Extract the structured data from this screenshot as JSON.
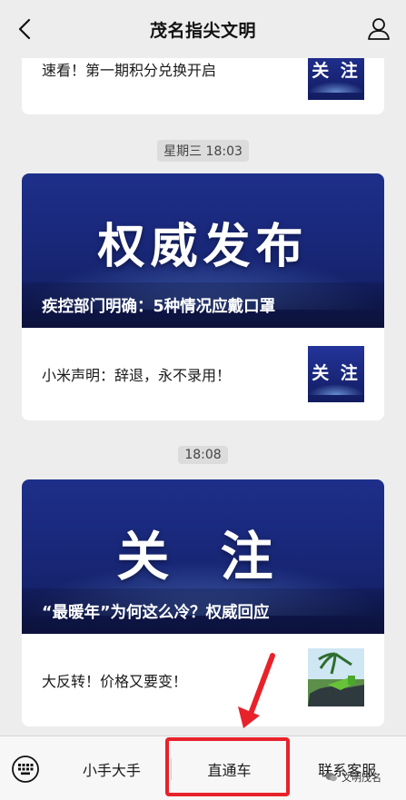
{
  "header": {
    "title": "茂名指尖文明"
  },
  "feed": {
    "card1": {
      "text": "速看！第一期积分兑换开启",
      "thumb_text": "关 注"
    },
    "timestamp1": "星期三 18:03",
    "card2": {
      "hero_text": "权威发布",
      "hero_caption": "疾控部门明确：5种情况应戴口罩",
      "row_text": "小米声明：辞退，永不录用！",
      "thumb_text": "关 注"
    },
    "timestamp2": "18:08",
    "card3": {
      "hero_text": "关 注",
      "hero_caption": "“最暖年”为何这么冷？权威回应",
      "row_text": "大反转！价格又要变！"
    }
  },
  "menu": {
    "tabs": [
      "小手大手",
      "直通车",
      "联系客服"
    ]
  },
  "watermark": {
    "text": "文明茂名"
  },
  "colors": {
    "highlight": "#e8222a",
    "hero_blue": "#172573"
  }
}
